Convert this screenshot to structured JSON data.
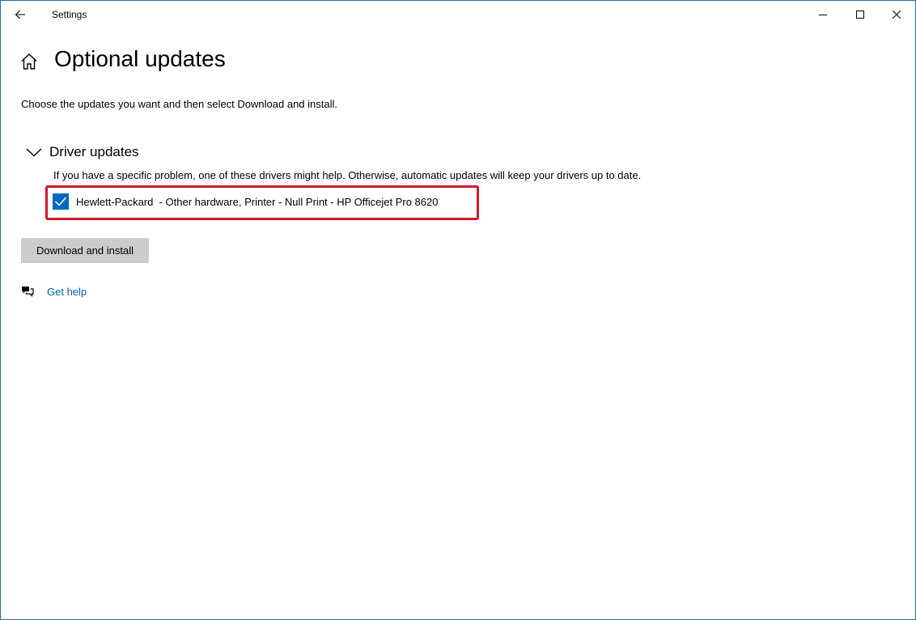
{
  "window": {
    "title": "Settings"
  },
  "page": {
    "title": "Optional updates",
    "intro": "Choose the updates you want and then select Download and install."
  },
  "driver_updates": {
    "header": "Driver updates",
    "expanded": true,
    "description": "If you have a specific problem, one of these drivers might help. Otherwise, automatic updates will keep your drivers up to date.",
    "items": [
      {
        "label": "Hewlett-Packard  - Other hardware, Printer - Null Print - HP Officejet Pro 8620",
        "checked": true
      }
    ]
  },
  "actions": {
    "download_label": "Download and install"
  },
  "help": {
    "label": "Get help"
  },
  "colors": {
    "accent": "#0067c0",
    "highlight_border": "#d0182c",
    "link": "#0063b1",
    "button_bg": "#cccccc",
    "window_border": "#1f6f93"
  },
  "icons": {
    "back": "back-arrow-icon",
    "home": "home-icon",
    "minimize": "minimize-icon",
    "maximize": "maximize-icon",
    "close": "close-icon",
    "chevron": "chevron-down-icon",
    "checkmark": "checkmark-icon",
    "help": "chat-help-icon"
  }
}
